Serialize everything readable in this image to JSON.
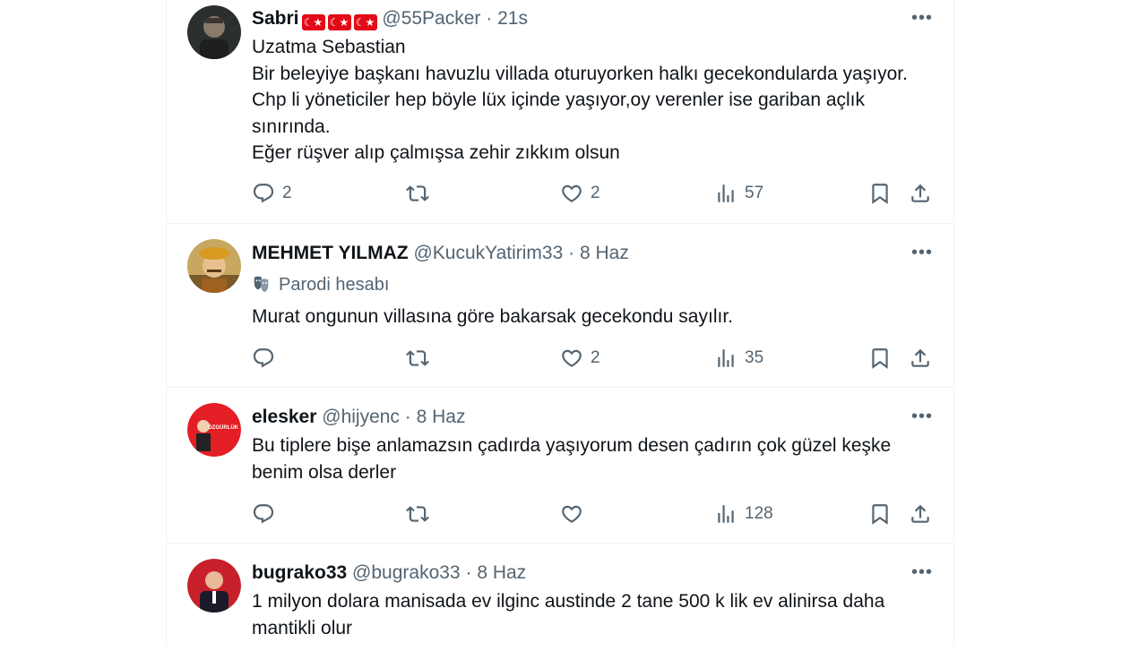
{
  "tweets": [
    {
      "name": "Sabri",
      "flags": [
        "☾★",
        "☾★",
        "☾★"
      ],
      "handle": "@55Packer",
      "time": "21s",
      "text": "Uzatma Sebastian\nBir beleyiye başkanı havuzlu villada oturuyorken halkı gecekondularda yaşıyor. Chp li yöneticiler hep böyle lüx içinde yaşıyor,oy verenler ise gariban açlık sınırında.\nEğer rüşver alıp çalmışsa zehir zıkkım olsun",
      "reply_count": "2",
      "retweet_count": "",
      "like_count": "2",
      "view_count": "57"
    },
    {
      "name": "MEHMET YILMAZ",
      "handle": "@KucukYatirim33",
      "time": "8 Haz",
      "parody_label": "Parodi hesabı",
      "text": "Murat ongunun villasına göre bakarsak gecekondu sayılır.",
      "reply_count": "",
      "retweet_count": "",
      "like_count": "2",
      "view_count": "35"
    },
    {
      "name": "elesker",
      "handle": "@hijyenc",
      "time": "8 Haz",
      "avatar_text": "ÖZGÜRLÜK",
      "text": "Bu tiplere bişe anlamazsın çadırda yaşıyorum desen çadırın çok güzel keşke benim olsa derler",
      "reply_count": "",
      "retweet_count": "",
      "like_count": "",
      "view_count": "128"
    },
    {
      "name": "bugrako33",
      "handle": "@bugrako33",
      "time": "8 Haz",
      "text": "1 milyon dolara manisada ev ilginc austinde 2 tane 500 k lik ev alinirsa daha mantikli olur"
    }
  ],
  "separator": "·",
  "more_label": "•••",
  "icons": {
    "reply": "reply-icon",
    "retweet": "retweet-icon",
    "like": "heart-icon",
    "views": "views-icon",
    "bookmark": "bookmark-icon",
    "share": "share-icon",
    "parody": "parody-mask-icon"
  },
  "colors": {
    "text": "#0f1419",
    "secondary": "#536471",
    "border": "#eff3f4",
    "flag_red": "#e30a17"
  }
}
